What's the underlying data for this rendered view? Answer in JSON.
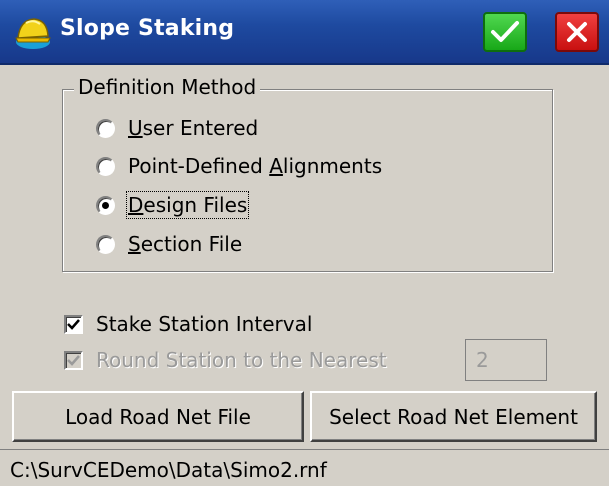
{
  "window": {
    "title": "Slope Staking"
  },
  "definition_method": {
    "label": "Definition Method",
    "options": [
      {
        "pre": "",
        "ul": "U",
        "post": "ser Entered",
        "checked": false
      },
      {
        "pre": "Point-Defined ",
        "ul": "A",
        "post": "lignments",
        "checked": false
      },
      {
        "pre": "",
        "ul": "D",
        "post": "esign Files",
        "checked": true
      },
      {
        "pre": "",
        "ul": "S",
        "post": "ection File",
        "checked": false
      }
    ]
  },
  "options": {
    "stake_station_interval": {
      "label": "Stake Station Interval",
      "checked": true
    },
    "round_station": {
      "label": "Round Station to the Nearest",
      "checked": true,
      "disabled": true,
      "value": "2"
    }
  },
  "buttons": {
    "load": "Load Road Net File",
    "select": "Select Road Net Element"
  },
  "status": {
    "path": "C:\\SurvCEDemo\\Data\\Simo2.rnf"
  }
}
